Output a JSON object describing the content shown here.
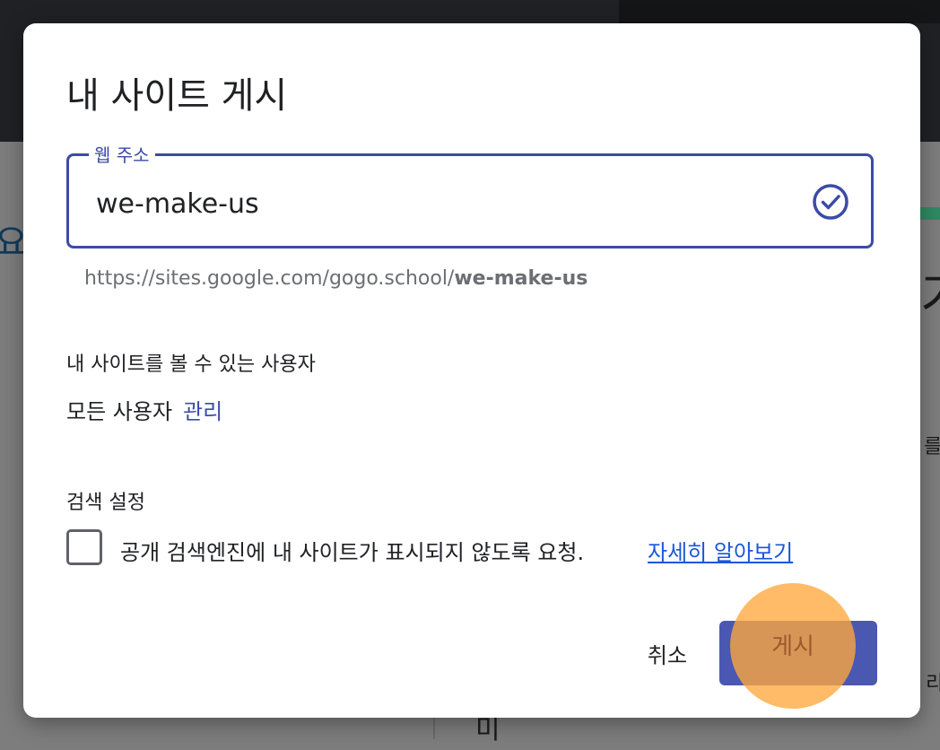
{
  "dialog": {
    "title": "내 사이트 게시",
    "web_address": {
      "label": "웹 주소",
      "value": "we-make-us",
      "status_icon": "check-circle-icon",
      "url_prefix": "https://sites.google.com/gogo.school/",
      "url_slug": "we-make-us"
    },
    "visibility": {
      "label": "내 사이트를 볼 수 있는 사용자",
      "value": "모든 사용자",
      "manage_link": "관리"
    },
    "search_settings": {
      "label": "검색 설정",
      "checkbox_label": "공개 검색엔진에 내 사이트가 표시되지 않도록 요청.",
      "checkbox_checked": false,
      "learn_more": "자세히 알아보기"
    },
    "actions": {
      "cancel": "취소",
      "publish": "게시"
    }
  },
  "background": {
    "fragments": [
      "요",
      "기",
      "를",
      "리",
      "미"
    ]
  },
  "colors": {
    "accent": "#3c4ba6",
    "button": "#4a58b2",
    "link": "#1a56db",
    "click_highlight": "#ffa83c"
  }
}
